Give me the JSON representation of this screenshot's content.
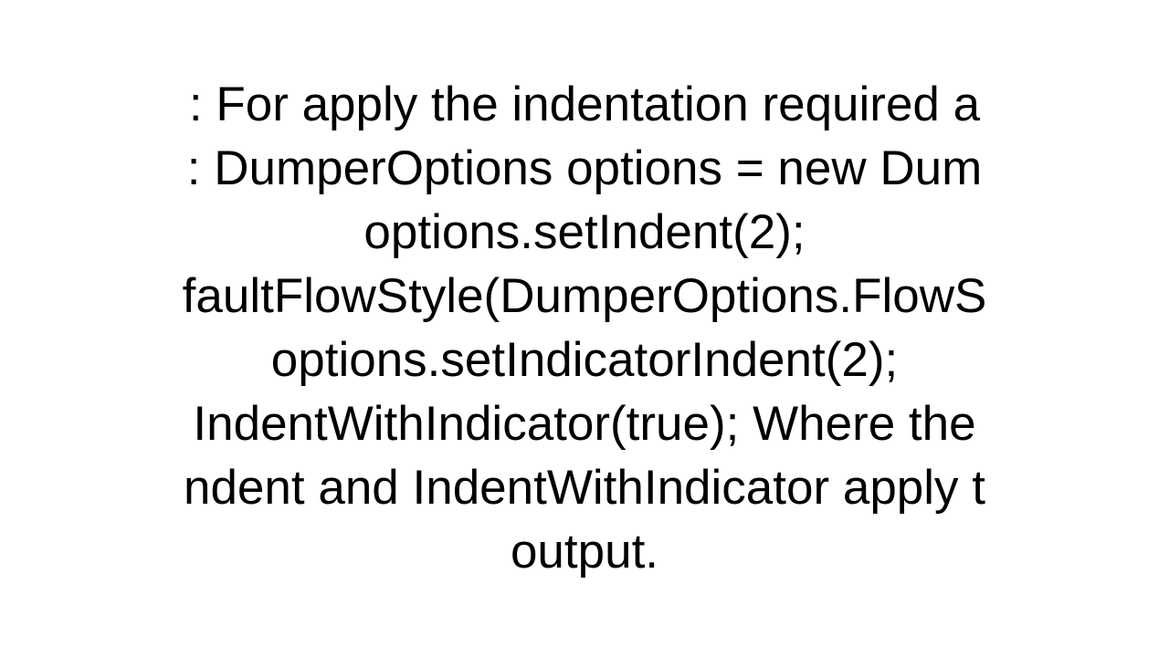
{
  "text": {
    "line1": ": For apply the indentation required a",
    "line2": ": DumperOptions options = new Dum",
    "line3": "options.setIndent(2);",
    "line4": "faultFlowStyle(DumperOptions.FlowS",
    "line5": "options.setIndicatorIndent(2);",
    "line6": "IndentWithIndicator(true);  Where the",
    "line7": "ndent and IndentWithIndicator apply t",
    "line8": "output."
  }
}
